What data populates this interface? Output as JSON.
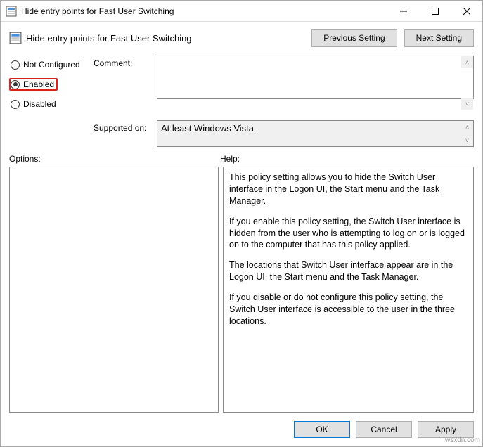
{
  "titlebar": {
    "title": "Hide entry points for Fast User Switching"
  },
  "header": {
    "title": "Hide entry points for Fast User Switching",
    "prev_label": "Previous Setting",
    "next_label": "Next Setting"
  },
  "radio": {
    "not_configured": "Not Configured",
    "enabled": "Enabled",
    "disabled": "Disabled",
    "selected": "enabled"
  },
  "comment_label": "Comment:",
  "comment_value": "",
  "supported_label": "Supported on:",
  "supported_value": "At least Windows Vista",
  "options_label": "Options:",
  "help_label": "Help:",
  "help": {
    "p1": "This policy setting allows you to hide the Switch User interface in the Logon UI, the Start menu and the Task Manager.",
    "p2": "If you enable this policy setting, the Switch User interface is hidden from the user who is attempting to log on or is logged on to the computer that has this policy applied.",
    "p3": "The locations that Switch User interface appear are in the Logon UI, the Start menu and the Task Manager.",
    "p4": "If you disable or do not configure this policy setting, the Switch User interface is accessible to the user in the three locations."
  },
  "footer": {
    "ok": "OK",
    "cancel": "Cancel",
    "apply": "Apply"
  },
  "watermark": "wsxdn.com"
}
